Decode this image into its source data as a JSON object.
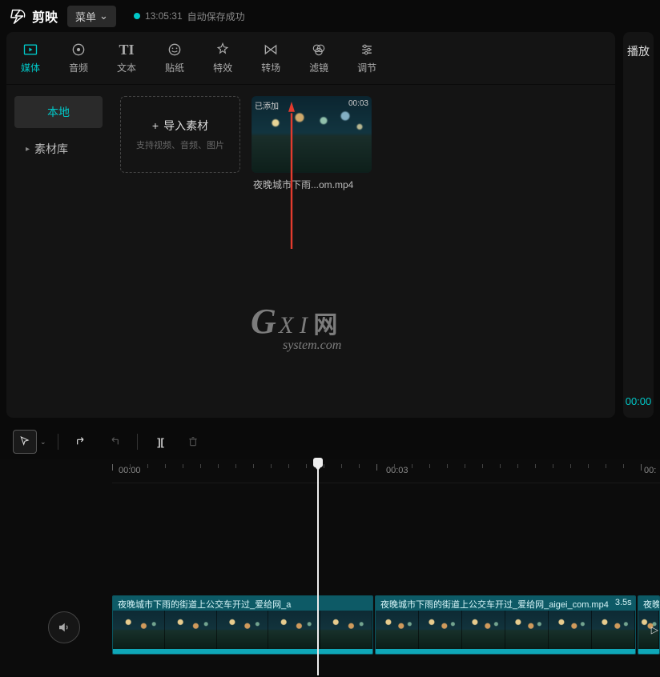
{
  "titlebar": {
    "app_name": "剪映",
    "menu_label": "菜单",
    "save_time": "13:05:31",
    "save_text": "自动保存成功"
  },
  "tabs": [
    {
      "id": "media",
      "label": "媒体",
      "active": true
    },
    {
      "id": "audio",
      "label": "音频",
      "active": false
    },
    {
      "id": "text",
      "label": "文本",
      "active": false
    },
    {
      "id": "sticker",
      "label": "贴纸",
      "active": false
    },
    {
      "id": "effect",
      "label": "特效",
      "active": false
    },
    {
      "id": "transition",
      "label": "转场",
      "active": false
    },
    {
      "id": "filter",
      "label": "滤镜",
      "active": false
    },
    {
      "id": "adjust",
      "label": "调节",
      "active": false
    }
  ],
  "sidebar": {
    "local": "本地",
    "library": "素材库"
  },
  "import": {
    "plus": "+",
    "label": "导入素材",
    "hint": "支持视频、音频、图片"
  },
  "media_item": {
    "badge_left": "已添加",
    "badge_right": "00:03",
    "filename": "夜晚城市下雨...om.mp4"
  },
  "watermark": {
    "g": "G",
    "xi": "X I",
    "han": "网",
    "sub": "system.com"
  },
  "right_panel": {
    "label": "播放",
    "time": "00:00"
  },
  "ruler": {
    "t0": "00:00",
    "t3": "00:03",
    "tEnd": "00:"
  },
  "clips": {
    "c1_name": "夜晚城市下雨的街道上公交车开过_爱给网_a",
    "c2_name": "夜晚城市下雨的街道上公交车开过_爱给网_aigei_com.mp4",
    "c2_dur": "3.5s",
    "c3_name": "夜晚"
  },
  "arrow_color": "#e33b2e"
}
